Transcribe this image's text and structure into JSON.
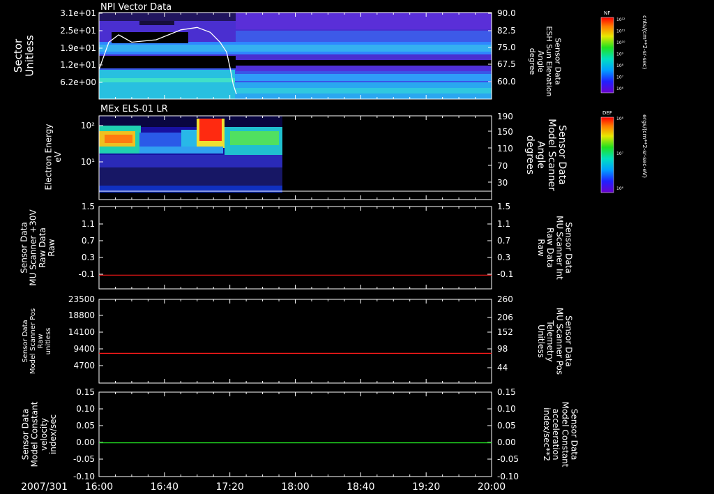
{
  "date_label": "2007/301",
  "time_ticks": [
    "16:00",
    "16:40",
    "17:20",
    "18:00",
    "18:40",
    "19:20",
    "20:00"
  ],
  "colors": {
    "red": "#ff1a1a",
    "green": "#22dd22",
    "white": "#ffffff",
    "axis": "#ffffff"
  },
  "chart_data": [
    {
      "type": "heatmap",
      "title": "NPI Vector Data",
      "ylabel_lines": [
        "Sector",
        "Unitless"
      ],
      "yticks": [
        "3.1e+01",
        "2.5e+01",
        "1.9e+01",
        "1.2e+01",
        "6.2e+00"
      ],
      "right_label_lines": [
        "Sensor Data",
        "ESH Sun Elevation",
        "Angle",
        "degree"
      ],
      "right_ticks": [
        "90.0",
        "82.5",
        "75.0",
        "67.5",
        "60.0"
      ],
      "ylim_right": [
        55,
        90
      ],
      "colorbar": {
        "title": "NF",
        "label": "cnts/(cm**2-sr-sec)",
        "ticks": [
          "10¹²",
          "10¹¹",
          "10¹⁰",
          "10⁹",
          "10⁸",
          "10⁷",
          "10⁶"
        ]
      },
      "overlay_line": {
        "name": "ESH Sun Elevation Angle",
        "x": [
          "16:00",
          "16:06",
          "16:12",
          "16:20",
          "16:35",
          "16:50",
          "17:00",
          "17:08",
          "17:14",
          "17:18",
          "17:20",
          "17:22",
          "17:24"
        ],
        "y": [
          67,
          78,
          81,
          78,
          79,
          83,
          84,
          82,
          78,
          74,
          68,
          61,
          57
        ]
      }
    },
    {
      "type": "heatmap",
      "title": "MEx ELS-01 LR",
      "ylabel_lines": [
        "Electron Energy",
        "eV"
      ],
      "yticks": [
        "10²",
        "10¹"
      ],
      "right_label_lines": [
        "Sensor Data",
        "Model Scanner",
        "Angle",
        "degrees"
      ],
      "right_ticks": [
        "190",
        "150",
        "110",
        "70",
        "30"
      ],
      "ylim_right": [
        10,
        190
      ],
      "data_end_time": "17:47",
      "colorbar": {
        "title": "DEF",
        "label": "ergs/(cm**2-sr-sec-eV)",
        "ticks": [
          "10⁸",
          "10⁷",
          "10⁶"
        ]
      }
    },
    {
      "type": "line",
      "ylabel_lines": [
        "Sensor Data",
        "MU Scanner +30V",
        "Raw Data",
        "Raw"
      ],
      "yticks": [
        "1.5",
        "1.1",
        "0.7",
        "0.3",
        "-0.1"
      ],
      "ylim": [
        -0.3,
        1.5
      ],
      "right_label_lines": [
        "Sensor Data",
        "MU Scanner Int",
        "Raw Data",
        "Raw"
      ],
      "right_ticks": [
        "1.5",
        "1.1",
        "0.7",
        "0.3",
        "-0.1"
      ],
      "series": [
        {
          "x": [
            "16:00",
            "20:00"
          ],
          "y": [
            0.0,
            0.0
          ],
          "color": "red"
        }
      ]
    },
    {
      "type": "line",
      "ylabel_lines": [
        "Sensor Data",
        "Model Scanner Pos",
        "Raw",
        "unitless"
      ],
      "yticks": [
        "23500",
        "18800",
        "14100",
        "9400",
        "4700"
      ],
      "ylim": [
        0,
        23500
      ],
      "right_label_lines": [
        "Sensor Data",
        "MU Scanner Pos",
        "Telemetry",
        "Unitless"
      ],
      "right_ticks": [
        "260",
        "206",
        "152",
        "98",
        "44"
      ],
      "series": [
        {
          "x": [
            "16:00",
            "20:00"
          ],
          "y": [
            8350,
            8350
          ],
          "color": "red"
        }
      ]
    },
    {
      "type": "line",
      "ylabel_lines": [
        "Sensor Data",
        "Model Constant",
        "velocity",
        "index/sec"
      ],
      "yticks": [
        "0.15",
        "0.10",
        "0.05",
        "0.00",
        "-0.05",
        "-0.10"
      ],
      "ylim": [
        -0.1,
        0.15
      ],
      "right_label_lines": [
        "Sensor Data",
        "Model Constant",
        "acceleration",
        "index/sec**2"
      ],
      "right_ticks": [
        "0.15",
        "0.10",
        "0.05",
        "0.00",
        "-0.05",
        "-0.10"
      ],
      "series": [
        {
          "x": [
            "16:00",
            "20:00"
          ],
          "y": [
            0.0,
            0.0
          ],
          "color": "green"
        }
      ]
    }
  ]
}
